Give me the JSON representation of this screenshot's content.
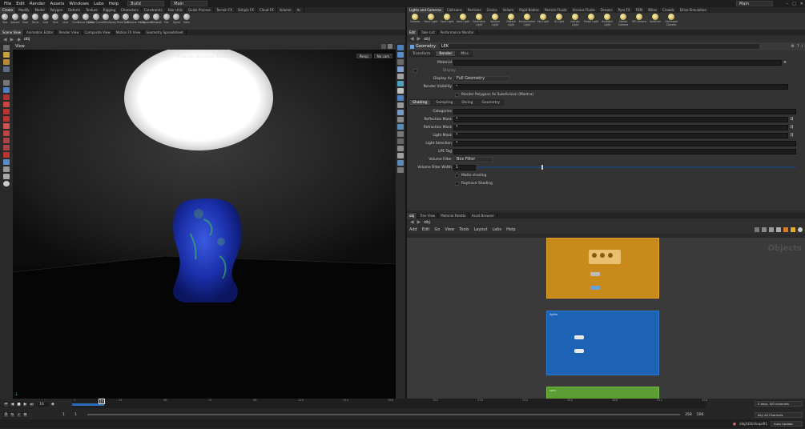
{
  "menubar": {
    "items": [
      "File",
      "Edit",
      "Render",
      "Assets",
      "Windows",
      "Labs",
      "Help"
    ],
    "desktop_build": "Build",
    "desktop_main": "Main",
    "right_main": "Main"
  },
  "left_shelf": {
    "tabs": [
      "Create",
      "Modify",
      "Model",
      "Polygon",
      "Deform",
      "Texture",
      "Rigging",
      "Characters",
      "Constraints",
      "Hair Utils",
      "Guide Process",
      "Terrain FX",
      "Simple FX",
      "Cloud FX",
      "Volume",
      "Ac"
    ],
    "tools": [
      "Box",
      "Sphere",
      "Tube",
      "Torus",
      "Grid",
      "Null",
      "Line",
      "Circle",
      "Curve Bezier",
      "Draw Curve",
      "Path",
      "Spray Paint",
      "Text",
      "Platonic Solids",
      "L-System",
      "Metaball",
      "File",
      "Spiral",
      "Helix"
    ]
  },
  "right_shelf": {
    "tabs": [
      "Lights and Cameras",
      "Collisions",
      "Particles",
      "Grains",
      "Vellum",
      "Rigid Bodies",
      "Particle Fluids",
      "Viscous Fluids",
      "Oceans",
      "Pyro FX",
      "FEM",
      "Wires",
      "Crowds",
      "Drive Simulation"
    ],
    "tools": [
      "Camera",
      "Point Light",
      "Spot Light",
      "Area Light",
      "Geometry Light",
      "Volume Light",
      "Distant Light",
      "Environment Light",
      "Sky Light",
      "GI Light",
      "Caustic Light",
      "Portal Light",
      "Ambient Light",
      "Stereo Camera",
      "VR Camera",
      "Switcher",
      "Gamepad Camera"
    ]
  },
  "left_pane": {
    "tabs": [
      "Scene View",
      "Animation Editor",
      "Render View",
      "Composite View",
      "Motion FX View",
      "Geometry Spreadsheet"
    ],
    "path": "obj",
    "view_label": "View",
    "overlay": "Dynamics Simulation Disabled",
    "persp": "Persp",
    "cam": "No cam"
  },
  "param_pane": {
    "tabs": [
      "Edit",
      "Take List",
      "Performance Monitor"
    ],
    "path": "obj",
    "node_type": "Geometry",
    "node_name": "LEK",
    "main_tabs": [
      "Transform",
      "Render",
      "Misc"
    ],
    "material_label": "Material",
    "display_label": "Display",
    "display_as_label": "Display As",
    "display_as_value": "Full Geometry",
    "render_vis_label": "Render Visibility",
    "render_vis_value": "*",
    "subdiv_label": "Render Polygons As Subdivision (Mantra)",
    "sub_tabs": [
      "Shading",
      "Sampling",
      "Dicing",
      "Geometry"
    ],
    "categories_label": "Categories",
    "reflection_label": "Reflection Mask",
    "reflection_value": "*",
    "refraction_label": "Refraction Mask",
    "refraction_value": "*",
    "lightmask_label": "Light Mask",
    "lightmask_value": "*",
    "lightsel_label": "Light Selection",
    "lightsel_value": "*",
    "lpe_label": "LPE Tag",
    "volfilter_label": "Volume Filter",
    "volfilter_value": "Box Filter",
    "volwidth_label": "Volume Filter Width",
    "volwidth_value": "1",
    "matte_label": "Matte shading",
    "raytrace_label": "Raytrace Shading"
  },
  "network_pane": {
    "tabs": [
      "obj",
      "Tree View",
      "Material Palette",
      "Asset Browser"
    ],
    "path": "obj",
    "menu": [
      "Add",
      "Edit",
      "Go",
      "View",
      "Tools",
      "Layout",
      "Labs",
      "Help"
    ],
    "watermark": "Objects",
    "box1_node1": "",
    "box1_node2_label": "",
    "box2_title": "lights",
    "box3_title": "cam"
  },
  "timeline": {
    "current_frame": "16",
    "start": "1",
    "start2": "1",
    "end": "358",
    "end2": "586",
    "ticks": [
      "1",
      "24",
      "48",
      "72",
      "96",
      "120",
      "144",
      "168",
      "192",
      "216",
      "240",
      "264",
      "288",
      "312",
      "336"
    ],
    "keys_info": "0 keys, 0/0 channels",
    "key_all": "Key All Channels",
    "status_path": "/obj/LEK/shapeR1",
    "auto_update": "Auto Update"
  },
  "colors": {
    "orange_box": "#c98a1c",
    "blue_box": "#1d63b5",
    "green_box": "#5c9e33",
    "head": "#1a2fa8"
  }
}
